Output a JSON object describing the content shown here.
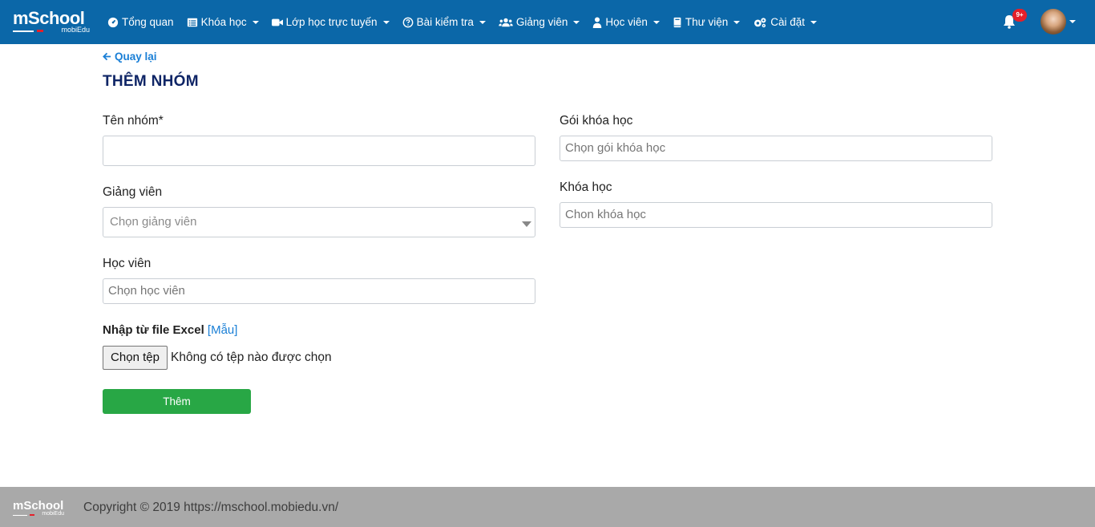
{
  "brand": {
    "logo_main": "mSchool",
    "logo_sub": "mobiEdu"
  },
  "nav": {
    "items": [
      {
        "label": "Tổng quan",
        "icon": "dashboard-icon",
        "has_caret": false
      },
      {
        "label": "Khóa học",
        "icon": "list-icon",
        "has_caret": true
      },
      {
        "label": "Lớp học trực tuyến",
        "icon": "video-icon",
        "has_caret": true
      },
      {
        "label": "Bài kiểm tra",
        "icon": "question-circle-icon",
        "has_caret": true
      },
      {
        "label": "Giảng viên",
        "icon": "users-icon",
        "has_caret": true
      },
      {
        "label": "Học viên",
        "icon": "user-icon",
        "has_caret": true
      },
      {
        "label": "Thư viện",
        "icon": "book-icon",
        "has_caret": true
      },
      {
        "label": "Cài đặt",
        "icon": "gears-icon",
        "has_caret": true
      }
    ],
    "notification_badge": "9+"
  },
  "page": {
    "back_label": "Quay lại",
    "title": "THÊM NHÓM"
  },
  "form": {
    "group_name_label": "Tên nhóm*",
    "group_name_value": "",
    "teacher_label": "Giảng viên",
    "teacher_placeholder": "Chọn giảng viên",
    "student_label": "Học viên",
    "student_placeholder": "Chọn học viên",
    "package_label": "Gói khóa học",
    "package_placeholder": "Chọn gói khóa học",
    "course_label": "Khóa học",
    "course_placeholder": "Chon khóa học",
    "import_label": "Nhập từ file Excel",
    "import_bracket_open": "[",
    "import_template_link": "Mẫu",
    "import_bracket_close": "]",
    "file_button": "Chọn tệp",
    "file_status": "Không có tệp nào được chọn",
    "submit_label": "Thêm"
  },
  "footer": {
    "logo_main": "mSchool",
    "logo_sub": "mobiEdu",
    "copyright": "Copyright © 2019 https://mschool.mobiedu.vn/"
  },
  "colors": {
    "navbar": "#0b67a8",
    "link": "#1a7fd6",
    "title": "#0f2566",
    "submit": "#28a745",
    "badge": "#e4202a",
    "footer": "#a9a9a9"
  }
}
